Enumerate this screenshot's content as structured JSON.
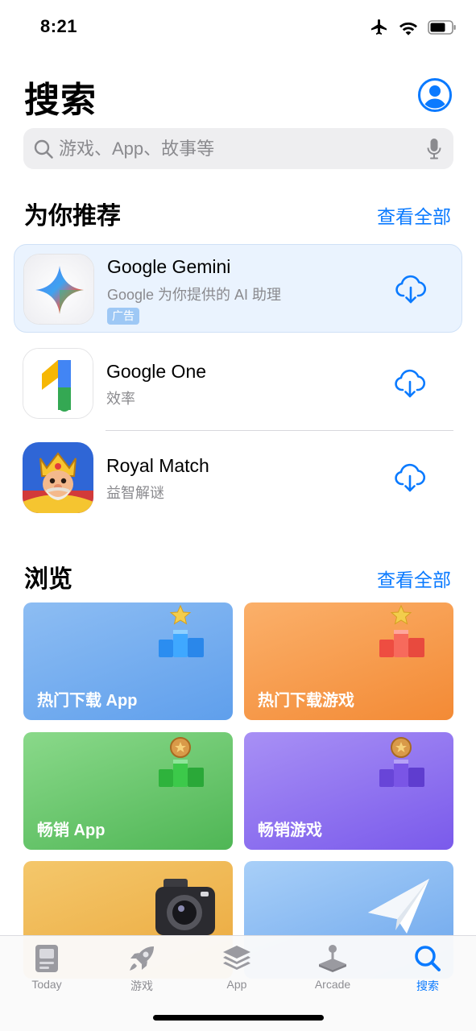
{
  "status": {
    "time": "8:21"
  },
  "header": {
    "title": "搜索"
  },
  "search": {
    "placeholder": "游戏、App、故事等"
  },
  "recommended": {
    "title": "为你推荐",
    "see_all": "查看全部",
    "apps": [
      {
        "name": "Google Gemini",
        "subtitle": "Google 为你提供的 AI 助理",
        "badge": "广告",
        "icon": "gemini-app-icon"
      },
      {
        "name": "Google One",
        "subtitle": "效率",
        "icon": "google-one-app-icon"
      },
      {
        "name": "Royal Match",
        "subtitle": "益智解谜",
        "icon": "royal-match-app-icon"
      }
    ]
  },
  "browse": {
    "title": "浏览",
    "see_all": "查看全部",
    "tiles": [
      {
        "label": "热门下载 App",
        "color": "#66a6ee",
        "icon": "podium-star-icon"
      },
      {
        "label": "热门下载游戏",
        "color": "#f79a47",
        "icon": "podium-star-icon"
      },
      {
        "label": "畅销 App",
        "color": "#5ec262",
        "icon": "podium-coin-icon"
      },
      {
        "label": "畅销游戏",
        "color": "#8a6cf1",
        "icon": "podium-coin-icon"
      },
      {
        "label": "",
        "color": "#eeb54e",
        "icon": "camera-icon"
      },
      {
        "label": "",
        "color": "#7fb3ee",
        "icon": "paper-plane-icon"
      }
    ]
  },
  "tabs": [
    {
      "label": "Today",
      "icon": "today-icon"
    },
    {
      "label": "游戏",
      "icon": "rocket-icon"
    },
    {
      "label": "App",
      "icon": "layers-icon"
    },
    {
      "label": "Arcade",
      "icon": "joystick-icon"
    },
    {
      "label": "搜索",
      "icon": "search-icon",
      "active": true
    }
  ],
  "colors": {
    "accent": "#0a7aff",
    "ad_background": "#eaf3fe"
  }
}
